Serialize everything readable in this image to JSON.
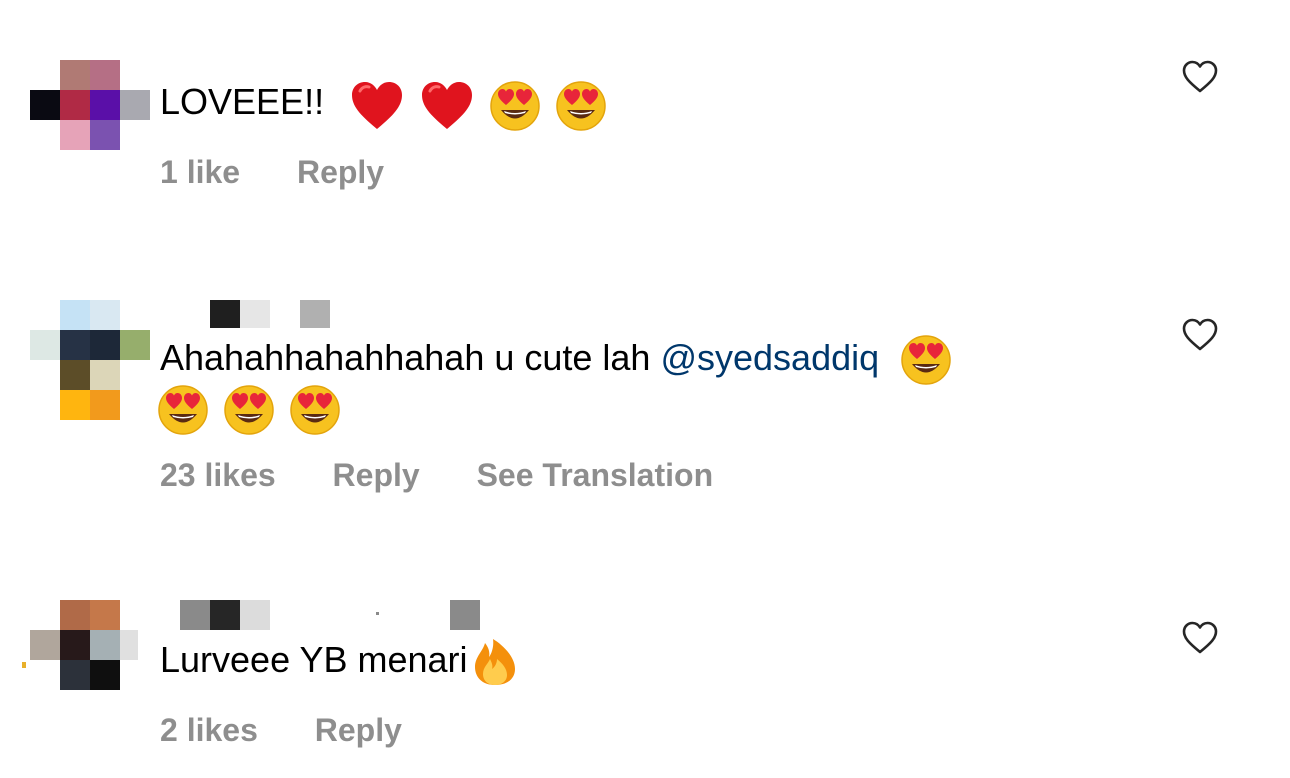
{
  "comments": [
    {
      "text": "LOVEEE!!",
      "emojis": [
        "red-heart",
        "red-heart",
        "heart-eyes",
        "heart-eyes"
      ],
      "likes_label": "1 like",
      "reply_label": "Reply",
      "heart_icon": "heart-outline-icon"
    },
    {
      "text": "Ahahahhahahhahah u cute lah",
      "mention": "@syedsaddiq",
      "emojis_line1": [
        "heart-eyes"
      ],
      "emojis_line2": [
        "heart-eyes",
        "heart-eyes",
        "heart-eyes"
      ],
      "likes_label": "23 likes",
      "reply_label": "Reply",
      "translate_label": "See Translation",
      "heart_icon": "heart-outline-icon"
    },
    {
      "text": "Lurveee YB menari",
      "emojis": [
        "fire"
      ],
      "likes_label": "2 likes",
      "reply_label": "Reply",
      "heart_icon": "heart-outline-icon"
    }
  ],
  "colors": {
    "text": "#000000",
    "meta": "#8e8e8e",
    "mention": "#00376b",
    "heart_outline": "#262626"
  }
}
